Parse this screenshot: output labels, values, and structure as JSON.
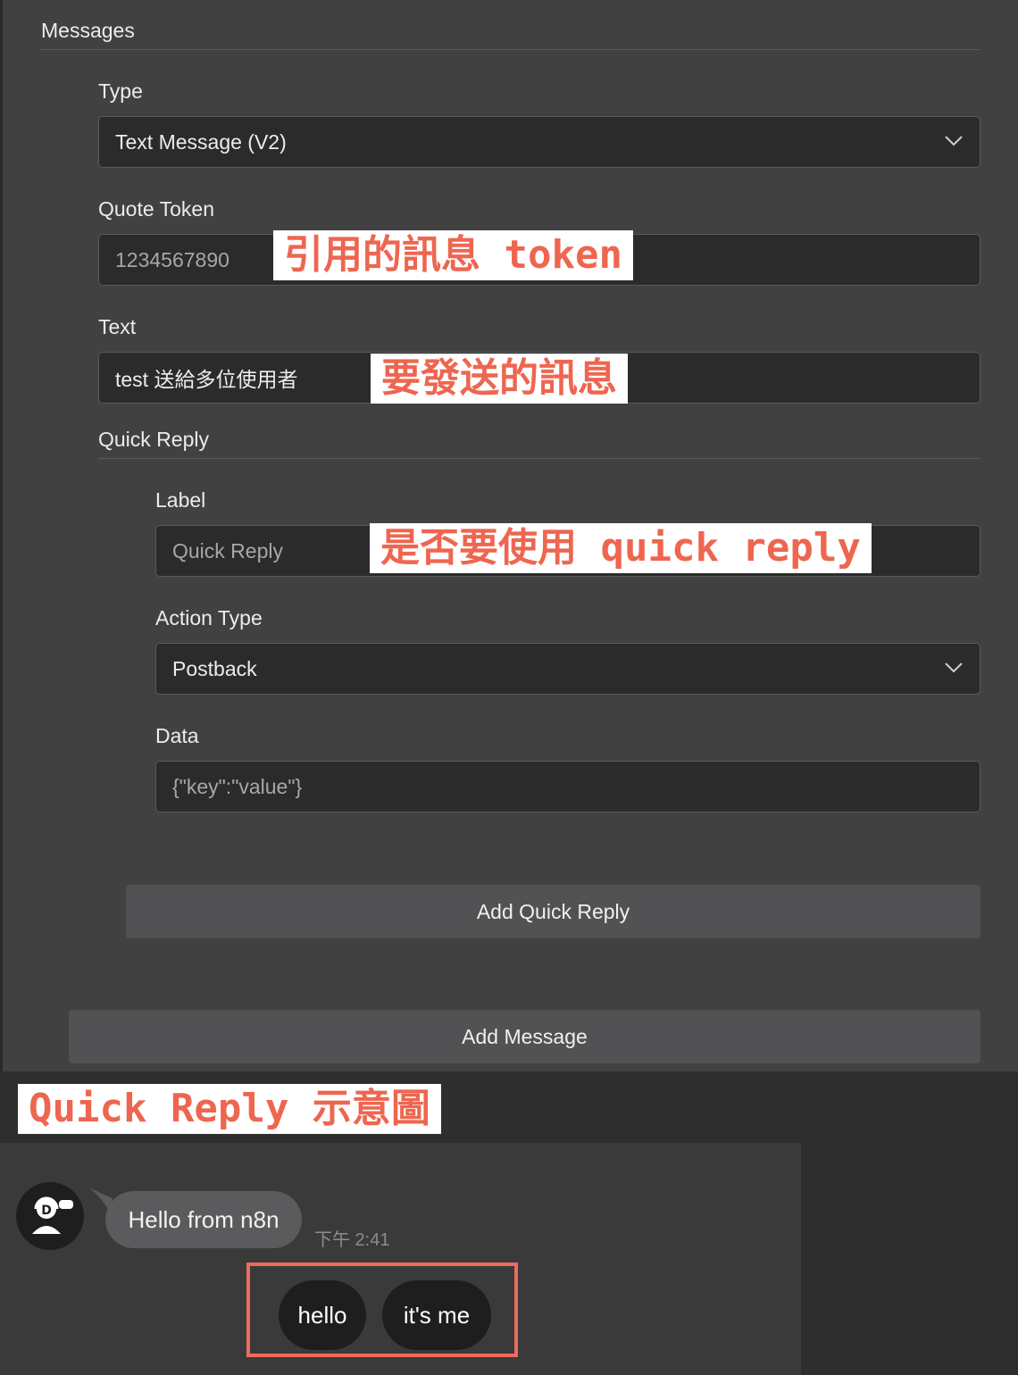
{
  "section": {
    "title": "Messages"
  },
  "type_field": {
    "label": "Type",
    "value": "Text Message (V2)"
  },
  "quote_token": {
    "label": "Quote Token",
    "placeholder": "1234567890",
    "annotation": "引用的訊息 token"
  },
  "text_field": {
    "label": "Text",
    "value": "test 送給多位使用者",
    "annotation": "要發送的訊息"
  },
  "quick_reply": {
    "title": "Quick Reply",
    "label_field": {
      "label": "Label",
      "placeholder": "Quick Reply",
      "annotation": "是否要使用 quick reply"
    },
    "action_type": {
      "label": "Action Type",
      "value": "Postback"
    },
    "data_field": {
      "label": "Data",
      "placeholder": "{\"key\":\"value\"}"
    },
    "add_button": "Add Quick Reply"
  },
  "add_message_button": "Add Message",
  "preview": {
    "annotation": "Quick Reply 示意圖",
    "message": "Hello from n8n",
    "time": "下午 2:41",
    "buttons": [
      "hello",
      "it's me"
    ]
  },
  "colors": {
    "panel_bg": "#414142",
    "field_bg": "#2b2b2c",
    "annotation_text": "#ee6650",
    "highlight_border": "#ef6b5c"
  },
  "icons": [
    "chevron-down-icon",
    "bot-avatar-icon"
  ]
}
